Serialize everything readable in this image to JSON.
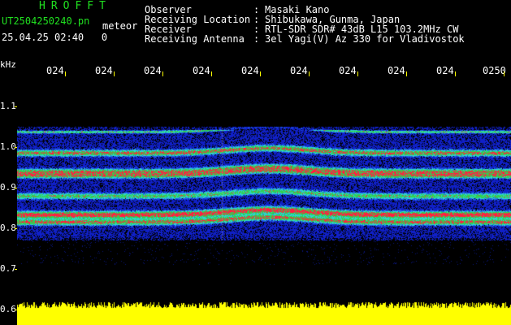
{
  "header": {
    "app_title": "HROFFT",
    "file_name": "UT2504250240.pn",
    "file_suffix": "meteor",
    "date_time": "25.04.25 02:40",
    "date_extra": "0",
    "info": [
      {
        "label": "Observer",
        "value": "Masaki Kano"
      },
      {
        "label": "Receiving Location",
        "value": "Shibukawa, Gunma, Japan"
      },
      {
        "label": "Receiver",
        "value": "RTL-SDR SDR# 43dB L15 103.2MHz CW"
      },
      {
        "label": "Receiving Antenna",
        "value": "3el Yagi(V) Az 330 for Vladivostok"
      }
    ]
  },
  "axis": {
    "unit": "kHz",
    "x_ticks": [
      "024",
      "024",
      "024",
      "024",
      "024",
      "024",
      "024",
      "024",
      "024",
      "0250"
    ],
    "y_ticks": [
      "1.1",
      "1.0",
      "0.9",
      "0.8",
      "0.7",
      "0.6"
    ]
  },
  "colors": {
    "text_green": "#20e020",
    "text_white": "#ffffff",
    "axis_yellow": "#ffff00",
    "noise_blue": "#1020c8",
    "band_cyan": "#30d0d0",
    "band_green": "#30d050",
    "band_red": "#ff2040",
    "background": "#000000"
  }
}
